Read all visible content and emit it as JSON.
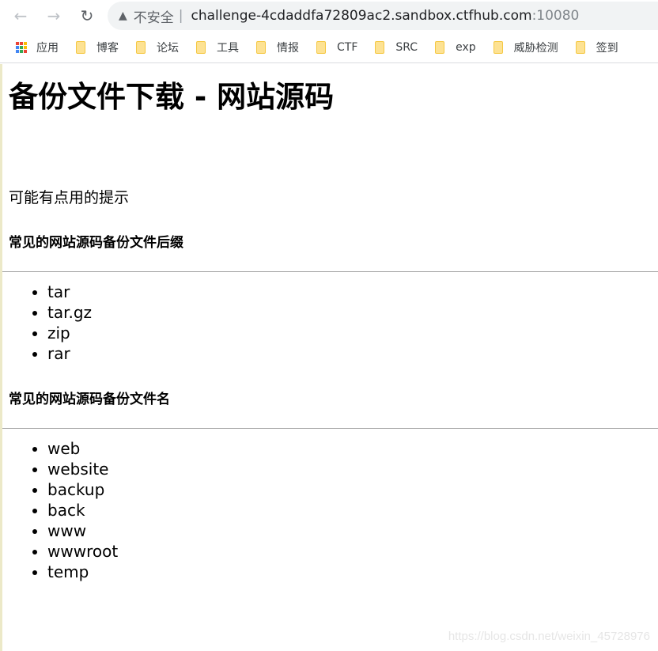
{
  "browser": {
    "insecure_label": "不安全",
    "url_host": "challenge-4cdaddfa72809ac2.sandbox.ctfhub.com",
    "url_port": ":10080",
    "bookmarks": [
      "应用",
      "博客",
      "论坛",
      "工具",
      "情报",
      "CTF",
      "SRC",
      "exp",
      "威胁检测",
      "签到"
    ]
  },
  "page": {
    "title": "备份文件下载 - 网站源码",
    "hint": "可能有点用的提示",
    "section1": {
      "heading": "常见的网站源码备份文件后缀",
      "items": [
        "tar",
        "tar.gz",
        "zip",
        "rar"
      ]
    },
    "section2": {
      "heading": "常见的网站源码备份文件名",
      "items": [
        "web",
        "website",
        "backup",
        "back",
        "www",
        "wwwroot",
        "temp"
      ]
    }
  },
  "watermark": "https://blog.csdn.net/weixin_45728976"
}
